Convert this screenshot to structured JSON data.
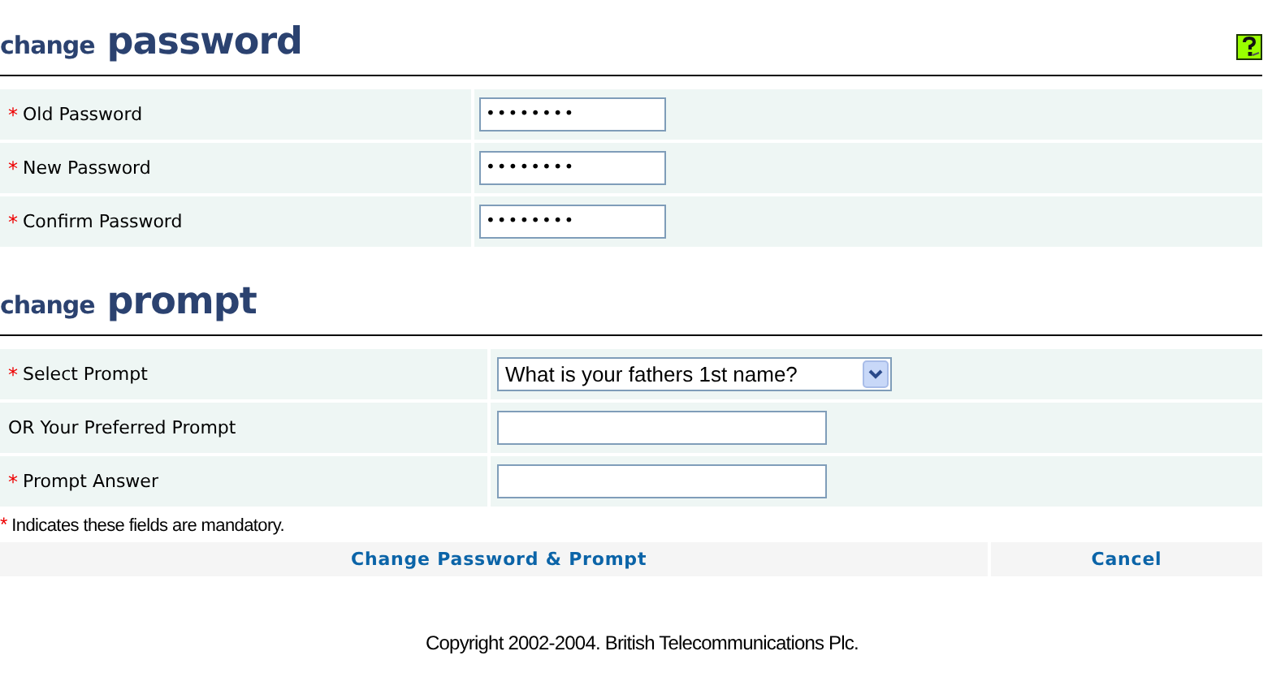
{
  "sections": [
    {
      "heading_small": "change",
      "heading_large": "password",
      "help": true,
      "fields": [
        {
          "mark": "*",
          "label": "Old Password",
          "kind": "password",
          "value": "••••••••"
        },
        {
          "mark": "*",
          "label": "New Password",
          "kind": "password",
          "value": "••••••••"
        },
        {
          "mark": "*",
          "label": "Confirm Password",
          "kind": "password",
          "value": "••••••••"
        }
      ]
    },
    {
      "heading_small": "change",
      "heading_large": "prompt",
      "help": false,
      "fields": [
        {
          "mark": "*",
          "label": "Select Prompt",
          "kind": "select",
          "value": "What is your fathers 1st name?"
        },
        {
          "label": "OR Your Preferred Prompt",
          "kind": "text"
        },
        {
          "mark": "*",
          "label": "Prompt Answer",
          "kind": "text"
        }
      ]
    }
  ],
  "note": {
    "mark": "*",
    "text": "Indicates these fields are mandatory."
  },
  "buttons": [
    "Change Password & Prompt",
    "Cancel"
  ],
  "footer": "Copyright 2002-2004. British Telecommunications Plc."
}
